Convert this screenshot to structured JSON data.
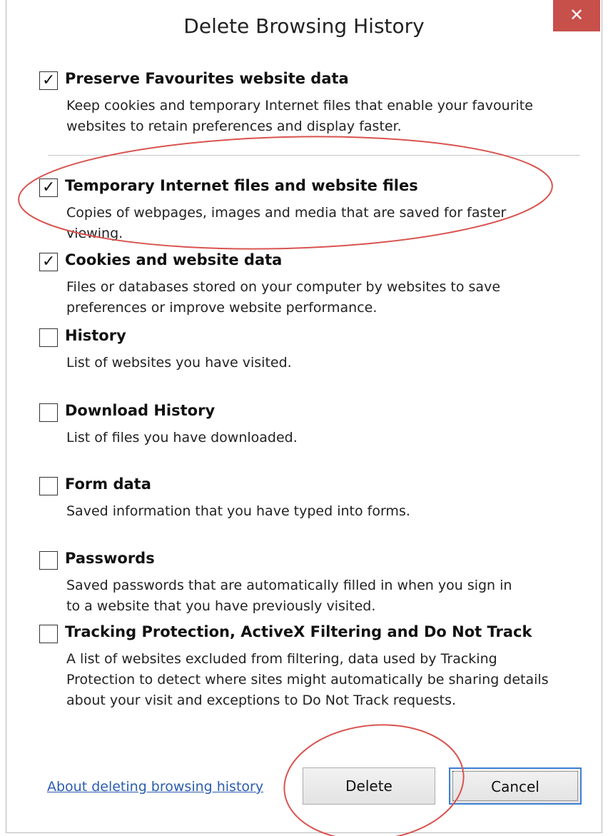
{
  "dialog": {
    "title": "Delete Browsing History",
    "close_label": "✕"
  },
  "options": [
    {
      "label": "Preserve Favourites website data",
      "description": "Keep cookies and temporary Internet files that enable your favourite\nwebsites to retain preferences and display faster.",
      "checked": true
    },
    {
      "label": "Temporary Internet files and website files",
      "description": "Copies of webpages, images and media that are saved for faster\nviewing.",
      "checked": true
    },
    {
      "label": "Cookies and website data",
      "description": "Files or databases stored on your computer by websites to save\npreferences or improve website performance.",
      "checked": true
    },
    {
      "label": "History",
      "description": "List of websites you have visited.",
      "checked": false
    },
    {
      "label": "Download History",
      "description": "List of files you have downloaded.",
      "checked": false
    },
    {
      "label": "Form data",
      "description": "Saved information that you have typed into forms.",
      "checked": false
    },
    {
      "label": "Passwords",
      "description": "Saved passwords that are automatically filled in when you sign in\nto a website that you have previously visited.",
      "checked": false
    },
    {
      "label": "Tracking Protection, ActiveX Filtering and Do Not Track",
      "description": "A list of websites excluded from filtering, data used by Tracking\nProtection to detect where sites might automatically be sharing details\nabout your visit and exceptions to Do Not Track requests.",
      "checked": false
    }
  ],
  "footer": {
    "about_link": "About deleting browsing history",
    "delete_label": "Delete",
    "cancel_label": "Cancel"
  },
  "check_glyph": "✓",
  "colors": {
    "close_button": "#c7504b",
    "link": "#2a5db0",
    "annotation": "#d9534f",
    "focus_border": "#3c7fd6"
  }
}
